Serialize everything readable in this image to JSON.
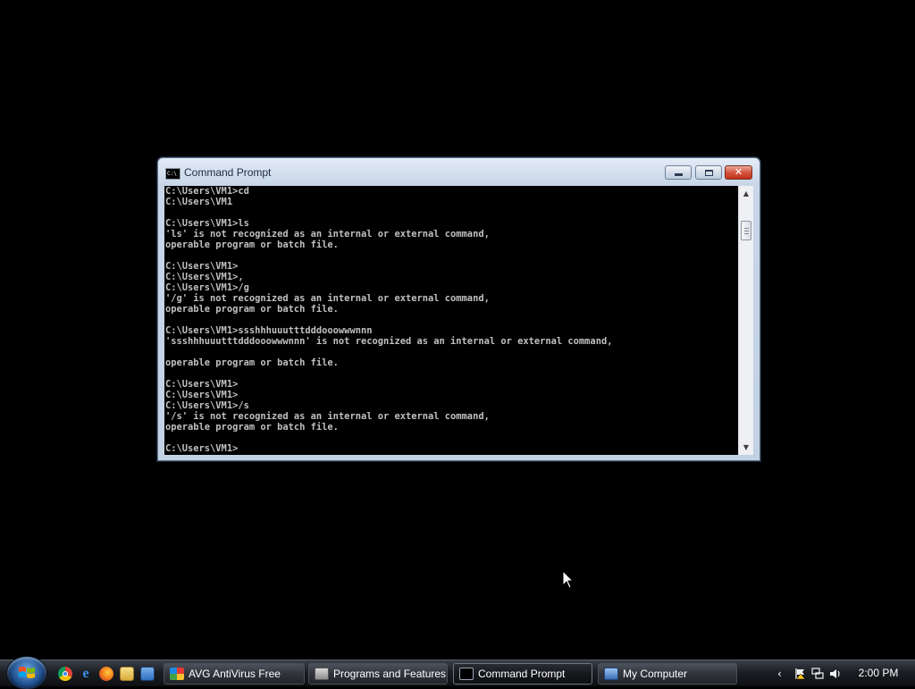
{
  "window": {
    "title": "Command Prompt",
    "console_lines": [
      "C:\\Users\\VM1>cd",
      "C:\\Users\\VM1",
      "",
      "C:\\Users\\VM1>ls",
      "'ls' is not recognized as an internal or external command,",
      "operable program or batch file.",
      "",
      "C:\\Users\\VM1>",
      "C:\\Users\\VM1>,",
      "C:\\Users\\VM1>/g",
      "'/g' is not recognized as an internal or external command,",
      "operable program or batch file.",
      "",
      "C:\\Users\\VM1>ssshhhuuutttdddooowwwnnn",
      "'ssshhhuuutttdddooowwwnnn' is not recognized as an internal or external command,",
      "",
      "operable program or batch file.",
      "",
      "C:\\Users\\VM1>",
      "C:\\Users\\VM1>",
      "C:\\Users\\VM1>/s",
      "'/s' is not recognized as an internal or external command,",
      "operable program or batch file.",
      "",
      "C:\\Users\\VM1>"
    ],
    "icon_glyph": "C:\\",
    "buttons": {
      "minimize": "minimize-icon",
      "maximize": "maximize-icon",
      "close": "close-icon"
    },
    "close_glyph": "✕"
  },
  "taskbar": {
    "quick_launch": [
      "chrome-icon",
      "internet-explorer-icon",
      "firefox-icon",
      "explorer-icon",
      "show-desktop-icon"
    ],
    "tasks": [
      {
        "label": "AVG AntiVirus Free",
        "icon": "avg-icon",
        "active": false
      },
      {
        "label": "Programs and Features",
        "icon": "programs-features-icon",
        "active": false
      },
      {
        "label": "Command Prompt",
        "icon": "cmd-icon",
        "active": true
      },
      {
        "label": "My Computer",
        "icon": "my-computer-icon",
        "active": false
      }
    ],
    "tray": {
      "icons": [
        "show-hidden-icons-arrow",
        "action-center-flag-icon",
        "network-icon",
        "volume-icon"
      ],
      "clock": "2:00 PM"
    }
  },
  "colors": {
    "console_bg": "#000000",
    "console_fg": "#c0c0c0",
    "desktop_bg": "#000000"
  }
}
